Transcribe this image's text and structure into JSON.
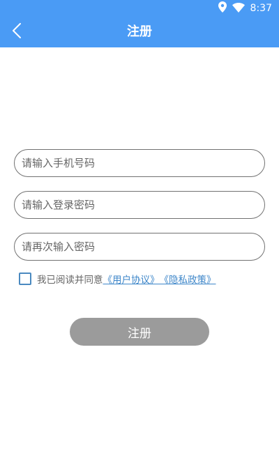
{
  "status_bar": {
    "time": "8:37"
  },
  "header": {
    "title": "注册"
  },
  "form": {
    "phone_placeholder": "请输入手机号码",
    "password_placeholder": "请输入登录密码",
    "confirm_placeholder": "请再次输入密码",
    "agree_text": "我已阅读并同意",
    "user_agreement": "《用户协议》",
    "privacy_policy": "《隐私政策》",
    "submit_label": "注册"
  },
  "colors": {
    "header_bg": "#4a9bf5",
    "button_disabled": "#9b9b9b",
    "link": "#3d86c9"
  }
}
